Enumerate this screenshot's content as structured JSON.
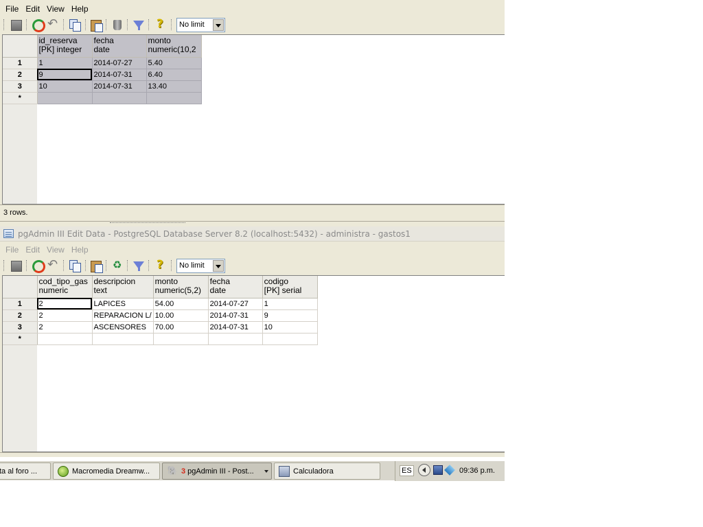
{
  "win1": {
    "menu": [
      "File",
      "Edit",
      "View",
      "Help"
    ],
    "limit": "No limit",
    "columns": [
      {
        "name": "id_reserva",
        "type": "[PK] integer"
      },
      {
        "name": "fecha",
        "type": "date"
      },
      {
        "name": "monto",
        "type": "numeric(10,2"
      }
    ],
    "rows": [
      {
        "num": "1",
        "cells": [
          "1",
          "2014-07-27",
          "5.40"
        ]
      },
      {
        "num": "2",
        "cells": [
          "9",
          "2014-07-31",
          "6.40"
        ]
      },
      {
        "num": "3",
        "cells": [
          "10",
          "2014-07-31",
          "13.40"
        ]
      }
    ],
    "new_row_marker": "*",
    "status": "3 rows."
  },
  "win2": {
    "title": "pgAdmin III Edit Data - PostgreSQL Database Server 8.2 (localhost:5432) - administra - gastos1",
    "menu": [
      "File",
      "Edit",
      "View",
      "Help"
    ],
    "limit": "No limit",
    "columns": [
      {
        "name": "cod_tipo_gas",
        "type": "numeric"
      },
      {
        "name": "descripcion",
        "type": "text"
      },
      {
        "name": "monto",
        "type": "numeric(5,2)"
      },
      {
        "name": "fecha",
        "type": "date"
      },
      {
        "name": "codigo",
        "type": "[PK] serial"
      }
    ],
    "rows": [
      {
        "num": "1",
        "cells": [
          "2",
          "LAPICES",
          "54.00",
          "2014-07-27",
          "1"
        ]
      },
      {
        "num": "2",
        "cells": [
          "2",
          "REPARACION L/",
          "10.00",
          "2014-07-31",
          "9"
        ]
      },
      {
        "num": "3",
        "cells": [
          "2",
          "ASCENSORES",
          "70.00",
          "2014-07-31",
          "10"
        ]
      }
    ],
    "new_row_marker": "*"
  },
  "taskbar": {
    "tasks": [
      {
        "label": "ta al foro ...",
        "icon": "browser-icon"
      },
      {
        "label": "Macromedia Dreamw...",
        "icon": "dreamweaver-icon"
      },
      {
        "label": "pgAdmin III - Post...",
        "badge": "3",
        "icon": "pgadmin-elephant-icon"
      },
      {
        "label": "Calculadora",
        "icon": "calculator-icon"
      }
    ],
    "language": "ES",
    "clock": "09:36 p.m."
  }
}
